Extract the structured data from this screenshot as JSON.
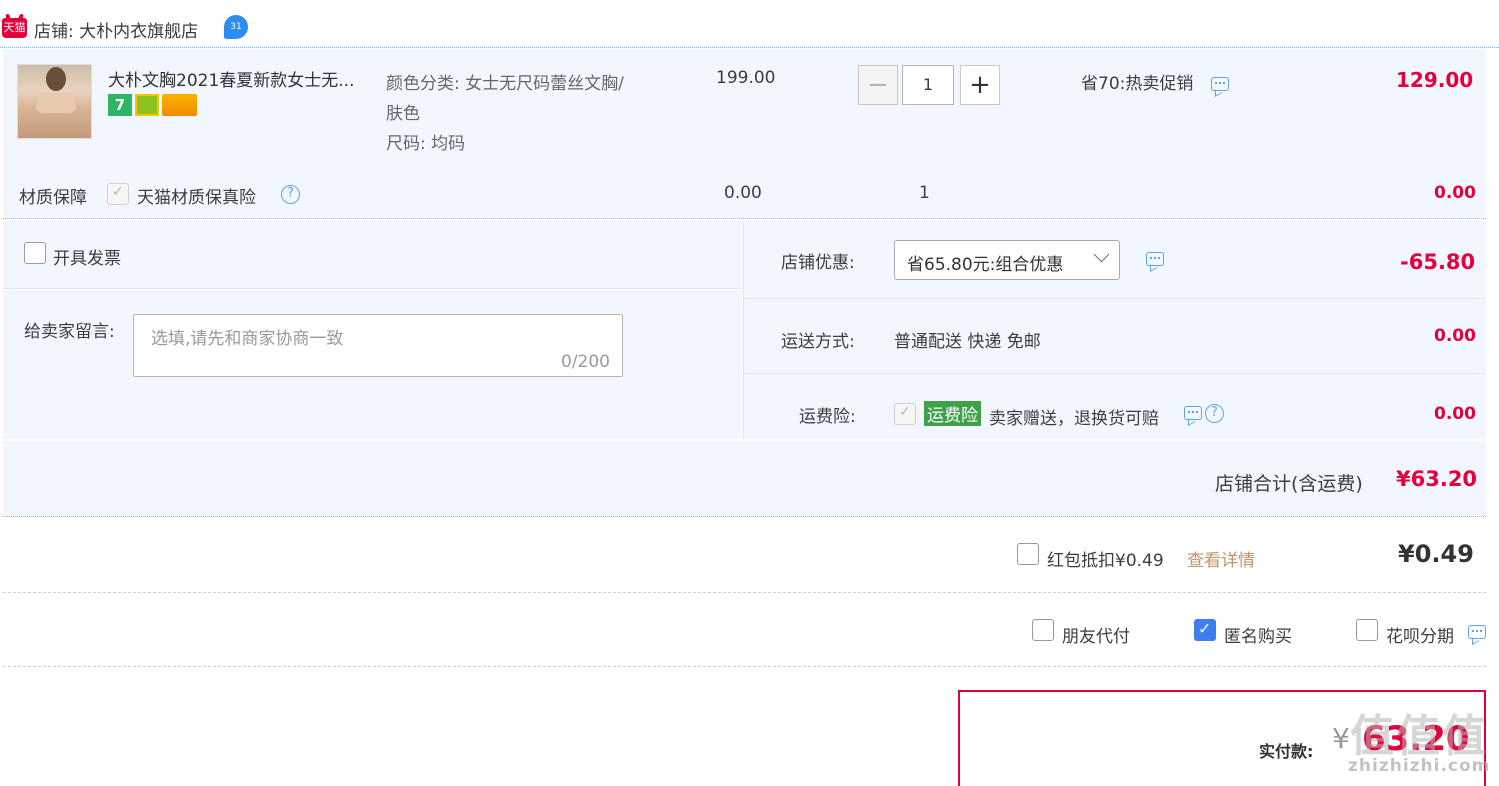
{
  "shop": {
    "platform_badge": "天猫",
    "name": "店铺: 大朴内衣旗舰店",
    "ww_badge": "31"
  },
  "item": {
    "title": "大朴文胸2021春夏新款女士无...",
    "badges": [
      "7",
      "",
      ""
    ],
    "sku_color": "颜色分类: 女士无尺码蕾丝文胸/",
    "sku_color_cont": "肤色",
    "sku_size": "尺码: 均码",
    "unit_price": "199.00",
    "quantity": "1",
    "qty_minus": "−",
    "qty_plus": "+",
    "promo": "省70:热卖促销",
    "subtotal": "129.00"
  },
  "insurance": {
    "label": "材质保障",
    "name": "天猫材质保真险",
    "price": "0.00",
    "qty": "1",
    "subtotal": "0.00"
  },
  "invoice": {
    "label": "开具发票"
  },
  "message": {
    "label": "给卖家留言:",
    "placeholder": "选填,请先和商家协商一致",
    "counter": "0/200"
  },
  "shop_discount": {
    "label": "店铺优惠:",
    "selected": "省65.80元:组合优惠",
    "amount": "-65.80"
  },
  "shipping": {
    "label": "运送方式:",
    "value": "普通配送 快递 免邮",
    "amount": "0.00"
  },
  "freight_insurance": {
    "label": "运费险:",
    "tag": "运费险",
    "desc": "卖家赠送，退换货可赔",
    "amount": "0.00"
  },
  "shop_total": {
    "label": "店铺合计(含运费)",
    "amount": "¥63.20"
  },
  "red_packet": {
    "label": "红包抵扣¥0.49",
    "link": "查看详情",
    "amount": "¥0.49"
  },
  "options": {
    "friend_pay": "朋友代付",
    "anonymous": "匿名购买",
    "huabei": "花呗分期"
  },
  "payment": {
    "label": "实付款:",
    "currency": "¥",
    "amount": "63.20"
  },
  "watermark": {
    "main": "值值值",
    "sub": "zhizhizhi.com"
  },
  "colors": {
    "price_red": "#e4003a",
    "panel_bg": "#f2f7ff",
    "check_blue": "#3d7ef0",
    "tag_green": "#3fa14a"
  }
}
